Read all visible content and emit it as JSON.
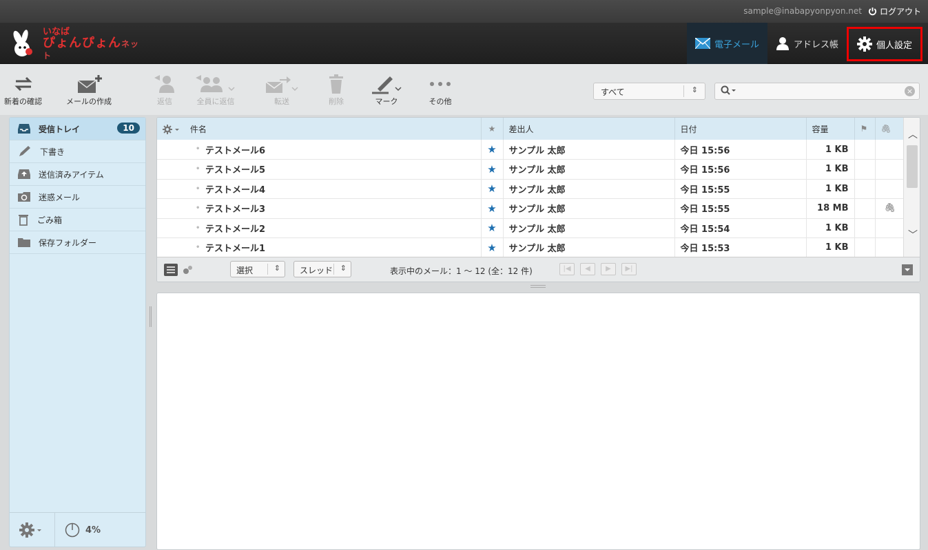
{
  "topbar": {
    "user_email": "sample@inabapyonpyon.net",
    "logout_label": "ログアウト"
  },
  "logo": {
    "line1": "いなば",
    "line2": "ぴょんぴょん",
    "line2b": "ネット"
  },
  "nav": {
    "email": "電子メール",
    "addressbook": "アドレス帳",
    "settings": "個人設定"
  },
  "toolbar": {
    "check_mail": "新着の確認",
    "compose": "メールの作成",
    "reply": "返信",
    "reply_all": "全員に返信",
    "forward": "転送",
    "delete": "削除",
    "mark": "マーク",
    "more": "その他"
  },
  "filter": {
    "selected": "すべて"
  },
  "search": {
    "placeholder": ""
  },
  "folders": [
    {
      "label": "受信トレイ",
      "icon": "inbox-icon",
      "count": "10"
    },
    {
      "label": "下書き",
      "icon": "pencil-icon"
    },
    {
      "label": "送信済みアイテム",
      "icon": "sent-icon"
    },
    {
      "label": "迷惑メール",
      "icon": "junk-icon"
    },
    {
      "label": "ごみ箱",
      "icon": "trash-icon"
    },
    {
      "label": "保存フォルダー",
      "icon": "folder-icon"
    }
  ],
  "quota": "4%",
  "list": {
    "headers": {
      "subject": "件名",
      "from": "差出人",
      "date": "日付",
      "size": "容量"
    },
    "rows": [
      {
        "subject": "テストメール6",
        "from": "サンプル 太郎",
        "date": "今日 15:56",
        "size": "1 KB",
        "attachment": false
      },
      {
        "subject": "テストメール5",
        "from": "サンプル 太郎",
        "date": "今日 15:56",
        "size": "1 KB",
        "attachment": false
      },
      {
        "subject": "テストメール4",
        "from": "サンプル 太郎",
        "date": "今日 15:55",
        "size": "1 KB",
        "attachment": false
      },
      {
        "subject": "テストメール3",
        "from": "サンプル 太郎",
        "date": "今日 15:55",
        "size": "18 MB",
        "attachment": true
      },
      {
        "subject": "テストメール2",
        "from": "サンプル 太郎",
        "date": "今日 15:54",
        "size": "1 KB",
        "attachment": false
      },
      {
        "subject": "テストメール1",
        "from": "サンプル 太郎",
        "date": "今日 15:53",
        "size": "1 KB",
        "attachment": false
      }
    ]
  },
  "listfooter": {
    "select_label": "選択",
    "thread_label": "スレッド",
    "page_info": "表示中のメール：1 ～ 12 (全：12 件)"
  },
  "colors": {
    "accent": "#3aa0d8",
    "badge": "#1e5775",
    "highlight_border": "#ee0000",
    "logo_red": "#e03030"
  }
}
